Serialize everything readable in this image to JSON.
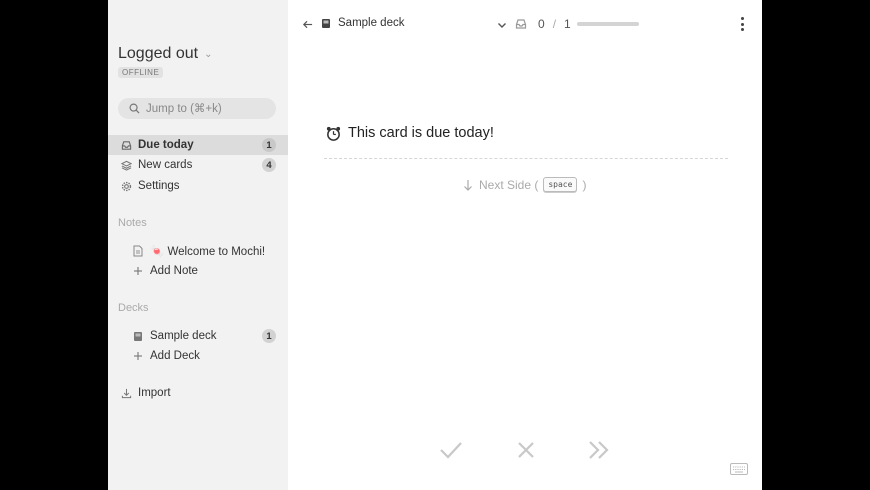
{
  "sidebar": {
    "user": {
      "name": "Logged out",
      "status_badge": "OFFLINE"
    },
    "search": {
      "placeholder": "Jump to (⌘+k)"
    },
    "nav": [
      {
        "label": "Due today",
        "count": "1",
        "icon": "inbox-icon",
        "active": true
      },
      {
        "label": "New cards",
        "count": "4",
        "icon": "layers-icon"
      },
      {
        "label": "Settings",
        "icon": "gear-icon"
      }
    ],
    "notes": {
      "title": "Notes",
      "items": [
        {
          "label": "🍬 Welcome to Mochi!",
          "icon": "document-icon"
        }
      ],
      "add_label": "Add Note"
    },
    "decks": {
      "title": "Decks",
      "items": [
        {
          "label": "Sample deck",
          "count": "1",
          "icon": "deck-icon"
        }
      ],
      "add_label": "Add Deck"
    },
    "import_label": "Import"
  },
  "topbar": {
    "deck_title": "Sample deck",
    "progress": {
      "current": "0",
      "separator": "/",
      "total": "1",
      "fraction": 0
    }
  },
  "card": {
    "front_text": "This card is due today!",
    "front_icon": "alarm-clock-icon",
    "next_side_label": "Next Side (",
    "next_side_close": ")",
    "next_side_key": "space"
  },
  "colors": {
    "sidebar_bg": "#f2f2f2",
    "active_item_bg": "#dcdcdc",
    "main_bg": "#ffffff",
    "muted_text": "#aaaaaa"
  }
}
